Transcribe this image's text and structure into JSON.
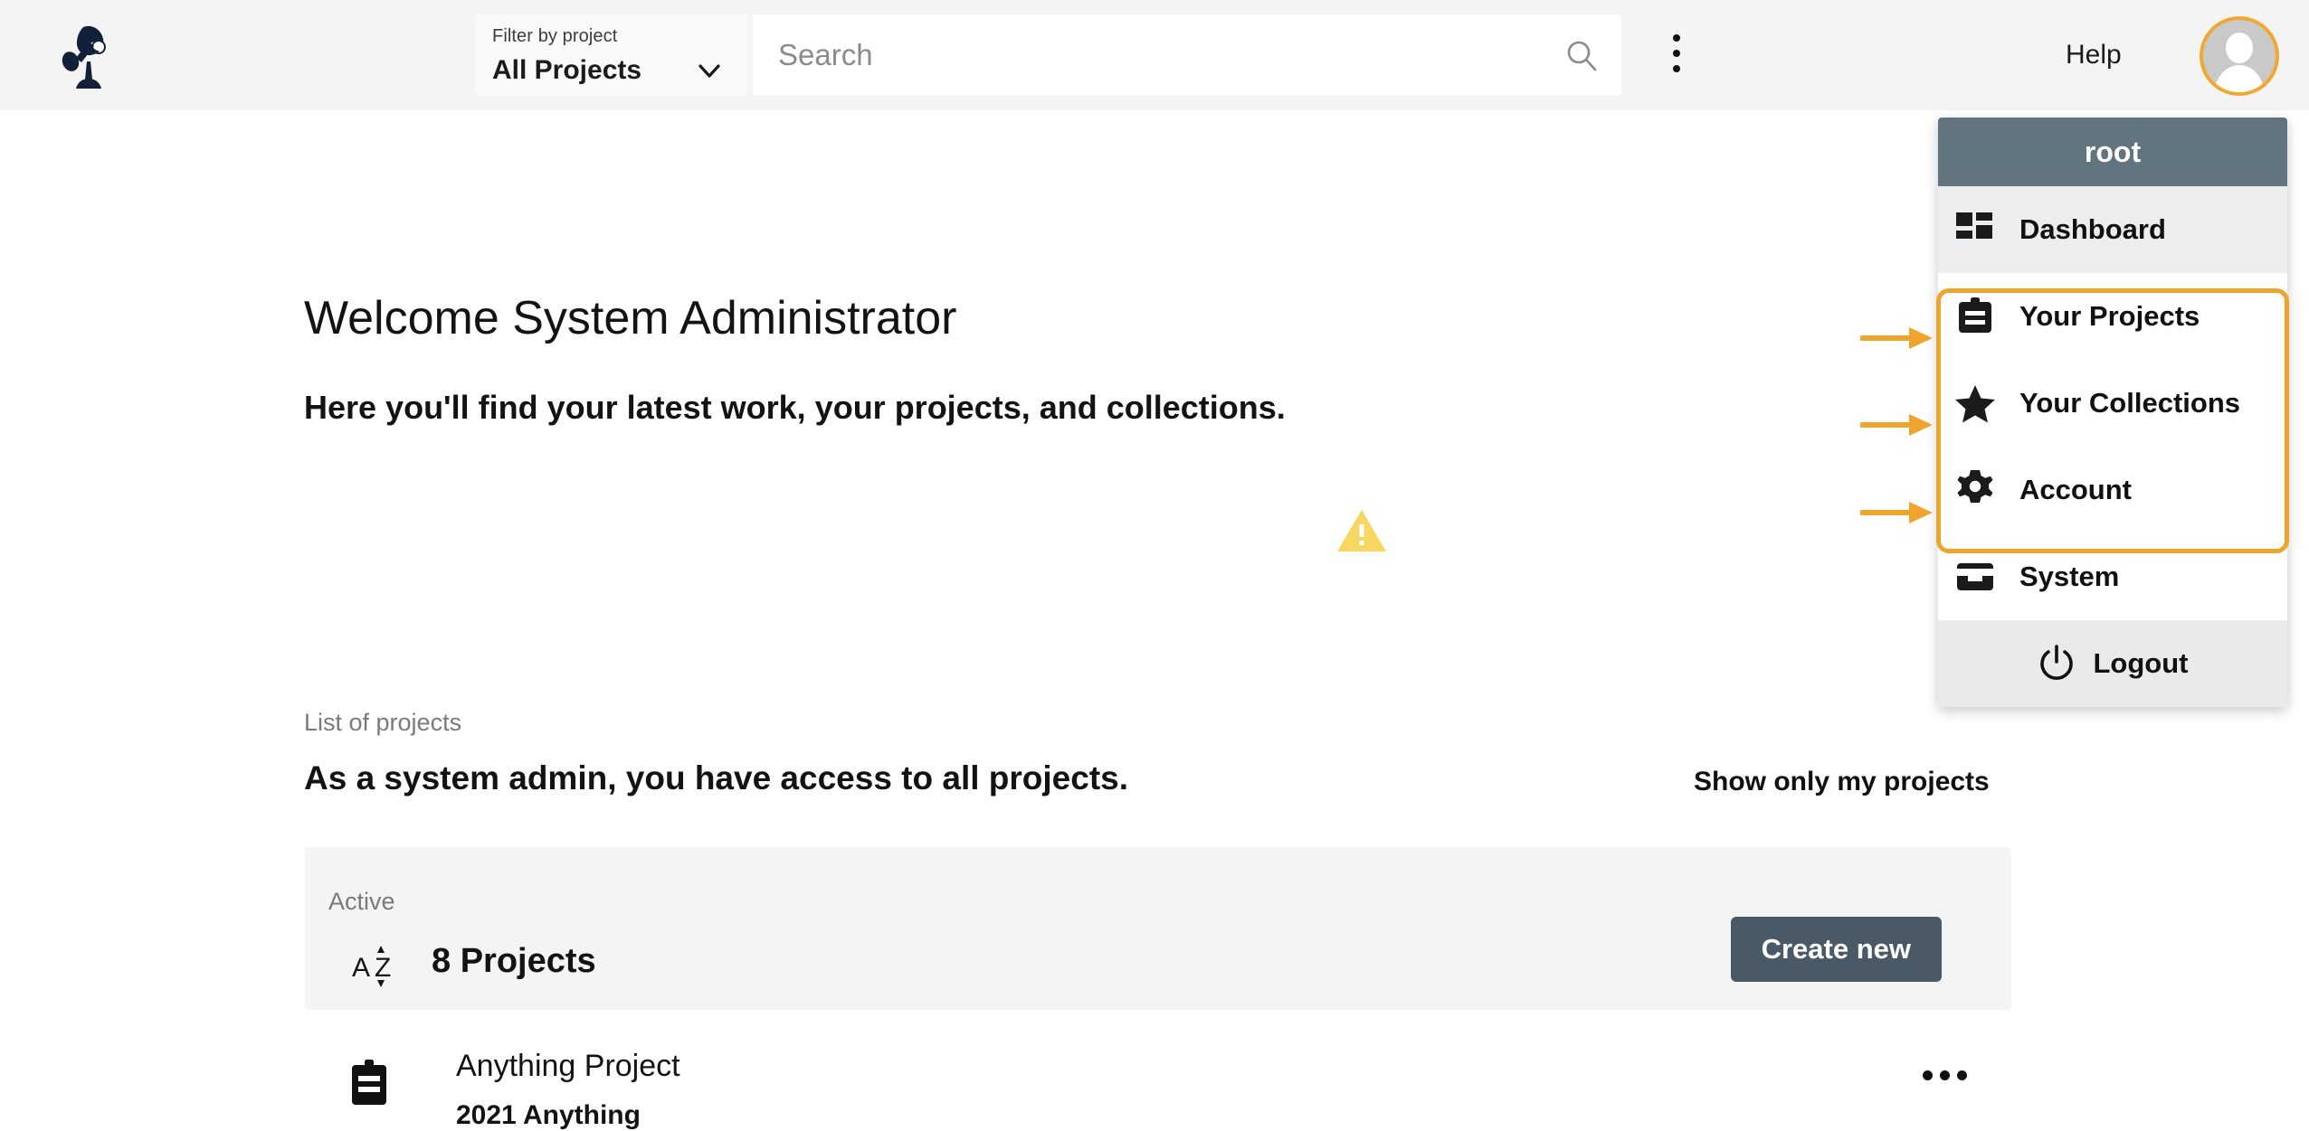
{
  "header": {
    "logo_icon": "omero-lamp-logo",
    "filter": {
      "label": "Filter by project",
      "value": "All Projects",
      "chevron_icon": "chevron-down-icon"
    },
    "search": {
      "placeholder": "Search",
      "value": "",
      "icon": "search-icon"
    },
    "kebab_icon": "more-vertical-icon",
    "help_label": "Help",
    "avatar_icon": "user-avatar-icon",
    "avatar_ring_color": "#f0a830"
  },
  "main": {
    "welcome_title": "Welcome System Administrator",
    "welcome_subtitle": "Here you'll find your latest work, your projects, and collections.",
    "warning_icon": "warning-triangle-icon",
    "warning_color": "#f5d761",
    "list_label": "List of projects",
    "list_headline": "As a system admin, you have access to all projects.",
    "show_only_my_projects": "Show only my projects",
    "active_card": {
      "label": "Active",
      "sort_icon": "sort-az-icon",
      "count_label": "8 Projects",
      "create_button": "Create new",
      "create_button_color": "#495a66"
    },
    "project_row": {
      "icon": "clipboard-icon",
      "name": "Anything Project",
      "meta": "2021 Anything",
      "more_icon": "more-horizontal-icon"
    }
  },
  "user_menu": {
    "username": "root",
    "header_color": "#62747f",
    "items": [
      {
        "label": "Dashboard",
        "icon": "dashboard-grid-icon",
        "highlighted": false
      },
      {
        "label": "Your Projects",
        "icon": "clipboard-icon",
        "highlighted": true
      },
      {
        "label": "Your Collections",
        "icon": "star-icon",
        "highlighted": true
      },
      {
        "label": "Account",
        "icon": "gear-icon",
        "highlighted": true
      },
      {
        "label": "System",
        "icon": "system-tray-icon",
        "highlighted": false
      }
    ],
    "logout": {
      "label": "Logout",
      "icon": "power-icon"
    },
    "highlight_color": "#eda52e",
    "annotation_arrows": 3
  }
}
